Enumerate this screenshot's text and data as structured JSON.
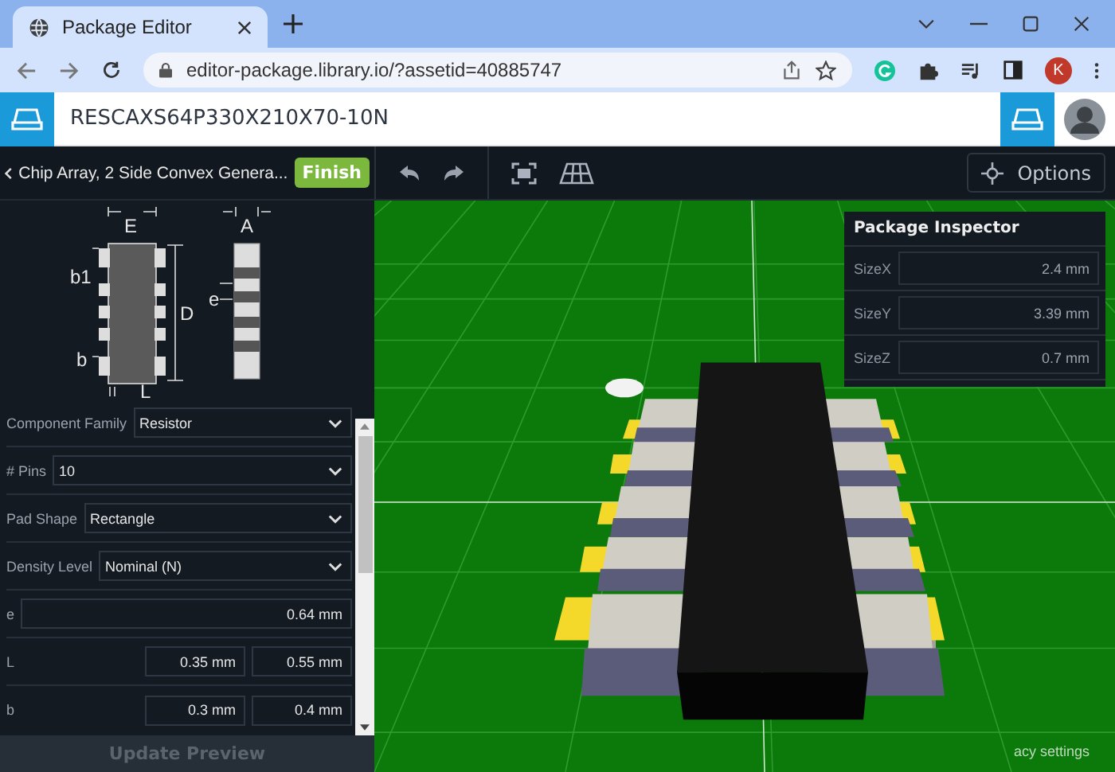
{
  "browser": {
    "tab": {
      "title": "Package Editor"
    },
    "url": "editor-package.library.io/?assetid=40885747",
    "profile_initial": "K"
  },
  "app": {
    "title": "RESCAXS64P330X210X70-10N"
  },
  "toolbar": {
    "package_name": "Chip Array, 2 Side Convex Genera...",
    "finish": "Finish",
    "options": "Options"
  },
  "diagram": {
    "labels": [
      "E",
      "A",
      "b1",
      "D",
      "e",
      "b",
      "L"
    ]
  },
  "form": [
    {
      "kind": "select",
      "label": "Component Family",
      "value": "Resistor"
    },
    {
      "kind": "select",
      "label": "# Pins",
      "value": "10"
    },
    {
      "kind": "select",
      "label": "Pad Shape",
      "value": "Rectangle"
    },
    {
      "kind": "select",
      "label": "Density Level",
      "value": "Nominal (N)"
    },
    {
      "kind": "single",
      "label": "e",
      "values": [
        "0.64 mm"
      ]
    },
    {
      "kind": "range",
      "label": "L",
      "values": [
        "0.35 mm",
        "0.55 mm"
      ]
    },
    {
      "kind": "range",
      "label": "b",
      "values": [
        "0.3 mm",
        "0.4 mm"
      ]
    }
  ],
  "update_button": {
    "label": "Update Preview",
    "disabled": true
  },
  "inspector": {
    "title": "Package Inspector",
    "rows": [
      {
        "label": "SizeX",
        "value": "2.4 mm"
      },
      {
        "label": "SizeY",
        "value": "3.39 mm"
      },
      {
        "label": "SizeZ",
        "value": "0.7 mm"
      }
    ]
  },
  "footer_link": "acy settings"
}
